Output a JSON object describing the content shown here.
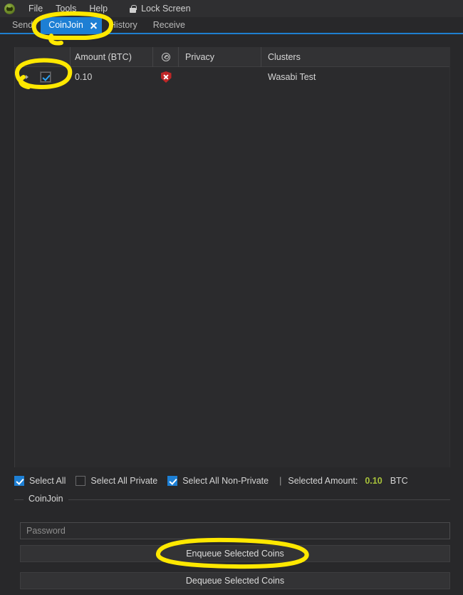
{
  "app": {
    "logo_icon": "wasabi-logo-icon"
  },
  "menubar": {
    "items": [
      {
        "label": "File"
      },
      {
        "label": "Tools"
      },
      {
        "label": "Help"
      }
    ],
    "lock": {
      "icon": "lock-icon",
      "label": "Lock Screen"
    }
  },
  "tabs": [
    {
      "label": "Send",
      "active": false,
      "closable": false
    },
    {
      "label": "CoinJoin",
      "active": true,
      "closable": true,
      "close_icon": "close-x-icon"
    },
    {
      "label": "History",
      "active": false,
      "closable": false
    },
    {
      "label": "Receive",
      "active": false,
      "closable": false
    }
  ],
  "table": {
    "headers": {
      "amount": "Amount (BTC)",
      "amount_icon": "anon-score-icon",
      "privacy": "Privacy",
      "clusters": "Clusters"
    },
    "rows": [
      {
        "expander_icon": "chevron-right-icon",
        "selected": true,
        "amount": "0.10",
        "privacy_icon": "shield-non-private-icon",
        "clusters": "Wasabi Test"
      }
    ]
  },
  "selection_bar": {
    "select_all": {
      "label": "Select All",
      "checked": true
    },
    "select_all_private": {
      "label": "Select All Private",
      "checked": false
    },
    "select_all_non_private": {
      "label": "Select All Non-Private",
      "checked": true
    },
    "divider": "|",
    "selected_amount_label": "Selected Amount:",
    "selected_amount_value": "0.10",
    "selected_amount_unit": "BTC"
  },
  "coinjoin_panel": {
    "title": "CoinJoin",
    "password_placeholder": "Password",
    "password_value": "",
    "enqueue_label": "Enqueue Selected Coins",
    "dequeue_label": "Dequeue Selected Coins"
  },
  "colors": {
    "accent_blue": "#1d7fd4",
    "annotation_yellow": "#ffe800",
    "amount_green": "#a7c23a",
    "privacy_red": "#c02727",
    "window_bg": "#28282a"
  },
  "annotations": [
    {
      "name": "coinjoin-tab-highlight",
      "shape": "circle-with-tail"
    },
    {
      "name": "row-checkbox-highlight",
      "shape": "circle-with-tail"
    },
    {
      "name": "enqueue-button-highlight",
      "shape": "ellipse"
    }
  ]
}
